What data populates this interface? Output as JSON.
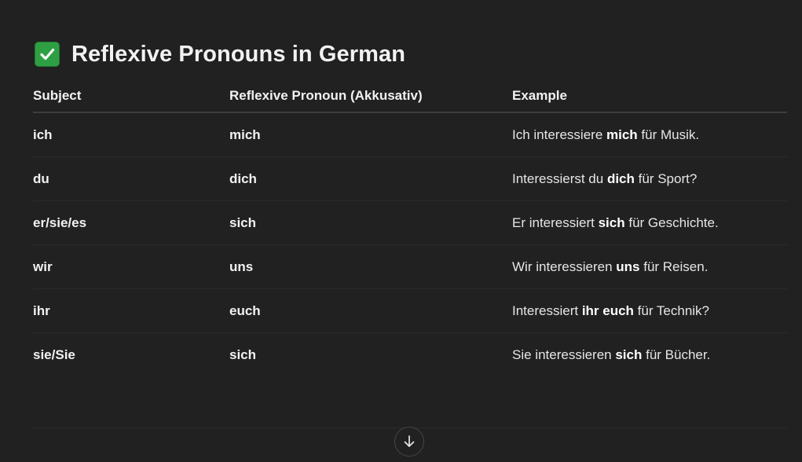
{
  "heading": {
    "icon": "check-mark-button-icon",
    "text": "Reflexive Pronouns in German"
  },
  "table": {
    "headers": [
      "Subject",
      "Reflexive Pronoun (Akkusativ)",
      "Example"
    ],
    "rows": [
      {
        "subject": "ich",
        "pronoun": "mich",
        "example": {
          "before": "Ich interessiere ",
          "bold": "mich",
          "after": " für Musik."
        }
      },
      {
        "subject": "du",
        "pronoun": "dich",
        "example": {
          "before": "Interessierst du ",
          "bold": "dich",
          "after": " für Sport?"
        }
      },
      {
        "subject": "er/sie/es",
        "pronoun": "sich",
        "example": {
          "before": "Er interessiert ",
          "bold": "sich",
          "after": " für Geschichte."
        }
      },
      {
        "subject": "wir",
        "pronoun": "uns",
        "example": {
          "before": "Wir interessieren ",
          "bold": "uns",
          "after": " für Reisen."
        }
      },
      {
        "subject": "ihr",
        "pronoun": "euch",
        "example": {
          "before": "Interessiert ",
          "bold": "ihr euch",
          "after": " für Technik?"
        }
      },
      {
        "subject": "sie/Sie",
        "pronoun": "sich",
        "example": {
          "before": "Sie interessieren ",
          "bold": "sich",
          "after": " für Bücher."
        }
      }
    ]
  },
  "scroll_button": {
    "icon": "arrow-down-icon"
  },
  "colors": {
    "background": "#212121",
    "check_green": "#2ea043"
  }
}
